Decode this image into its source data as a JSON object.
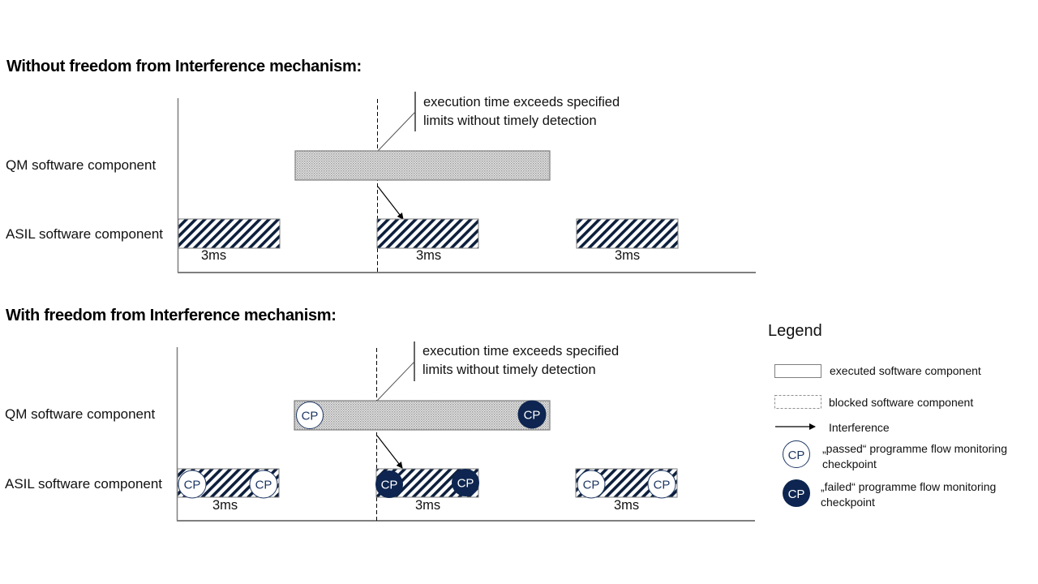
{
  "section_without": {
    "heading": "Without freedom from Interference mechanism:",
    "qm_label": "QM software component",
    "asil_label": "ASIL software component",
    "note_line1": "execution time exceeds specified",
    "note_line2": "limits without timely detection",
    "asil_tasks": [
      {
        "duration_label": "3ms"
      },
      {
        "duration_label": "3ms"
      },
      {
        "duration_label": "3ms"
      }
    ]
  },
  "section_with": {
    "heading": "With freedom from Interference mechanism:",
    "qm_label": "QM software component",
    "asil_label": "ASIL software component",
    "note_line1": "execution time exceeds specified",
    "note_line2": "limits without timely detection",
    "qm_checkpoints": [
      {
        "label": "CP",
        "status": "passed"
      },
      {
        "label": "CP",
        "status": "failed"
      }
    ],
    "asil_tasks": [
      {
        "duration_label": "3ms",
        "checkpoints": [
          {
            "label": "CP",
            "status": "passed"
          },
          {
            "label": "CP",
            "status": "passed"
          }
        ]
      },
      {
        "duration_label": "3ms",
        "checkpoints": [
          {
            "label": "CP",
            "status": "failed"
          },
          {
            "label": "CP",
            "status": "failed"
          }
        ]
      },
      {
        "duration_label": "3ms",
        "checkpoints": [
          {
            "label": "CP",
            "status": "passed"
          },
          {
            "label": "CP",
            "status": "passed"
          }
        ]
      }
    ]
  },
  "legend": {
    "title": "Legend",
    "executed": "executed software component",
    "blocked": "blocked software component",
    "interference": "Interference",
    "passed_line1": "„passed“ programme flow monitoring",
    "passed_line2": "checkpoint",
    "failed_line1": "„failed“ programme flow monitoring",
    "failed_line2": "checkpoint",
    "cp_label": "CP"
  },
  "colors": {
    "failed_fill": "#0d2550",
    "hatch": "#0d1f3c",
    "qm_fill": "#d9d9d9",
    "axis": "#7f7f7f"
  }
}
